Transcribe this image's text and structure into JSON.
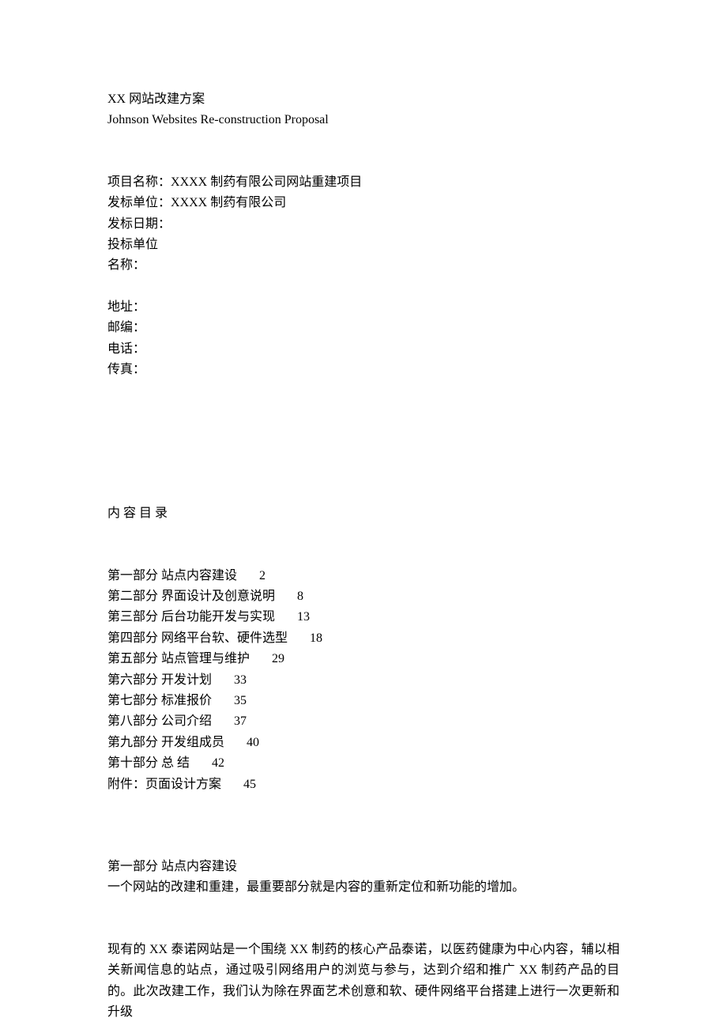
{
  "header": {
    "title_cn": "XX 网站改建方案",
    "title_en": "Johnson Websites Re-construction Proposal"
  },
  "project": {
    "name_label": "项目名称：",
    "name_value": "XXXX 制药有限公司网站重建项目",
    "issuer_label": "发标单位：",
    "issuer_value": "XXXX 制药有限公司",
    "issue_date_label": "发标日期：",
    "bidder_unit_label": "投标单位",
    "name2_label": "名称："
  },
  "contact": {
    "address_label": "地址：",
    "postcode_label": "邮编：",
    "phone_label": "电话：",
    "fax_label": "传真："
  },
  "toc": {
    "heading": "内 容 目 录",
    "entries": [
      {
        "label": "第一部分  站点内容建设",
        "page": "2"
      },
      {
        "label": "第二部分  界面设计及创意说明",
        "page": "8"
      },
      {
        "label": "第三部分  后台功能开发与实现",
        "page": "13"
      },
      {
        "label": "第四部分  网络平台软、硬件选型",
        "page": "18"
      },
      {
        "label": "第五部分  站点管理与维护",
        "page": "29"
      },
      {
        "label": "第六部分  开发计划",
        "page": "33"
      },
      {
        "label": "第七部分  标准报价",
        "page": "35"
      },
      {
        "label": "第八部分  公司介绍",
        "page": "37"
      },
      {
        "label": "第九部分  开发组成员",
        "page": "40"
      },
      {
        "label": "第十部分  总 结",
        "page": "42"
      },
      {
        "label": "附件：页面设计方案",
        "page": "45"
      }
    ]
  },
  "section1": {
    "heading": "第一部分  站点内容建设",
    "intro": "一个网站的改建和重建，最重要部分就是内容的重新定位和新功能的增加。",
    "para1": "现有的 XX 泰诺网站是一个围绕 XX 制药的核心产品泰诺，以医药健康为中心内容，辅以相关新闻信息的站点，通过吸引网络用户的浏览与参与，达到介绍和推广 XX 制药产品的目的。此次改建工作，我们认为除在界面艺术创意和软、硬件网络平台搭建上进行一次更新和升级"
  }
}
